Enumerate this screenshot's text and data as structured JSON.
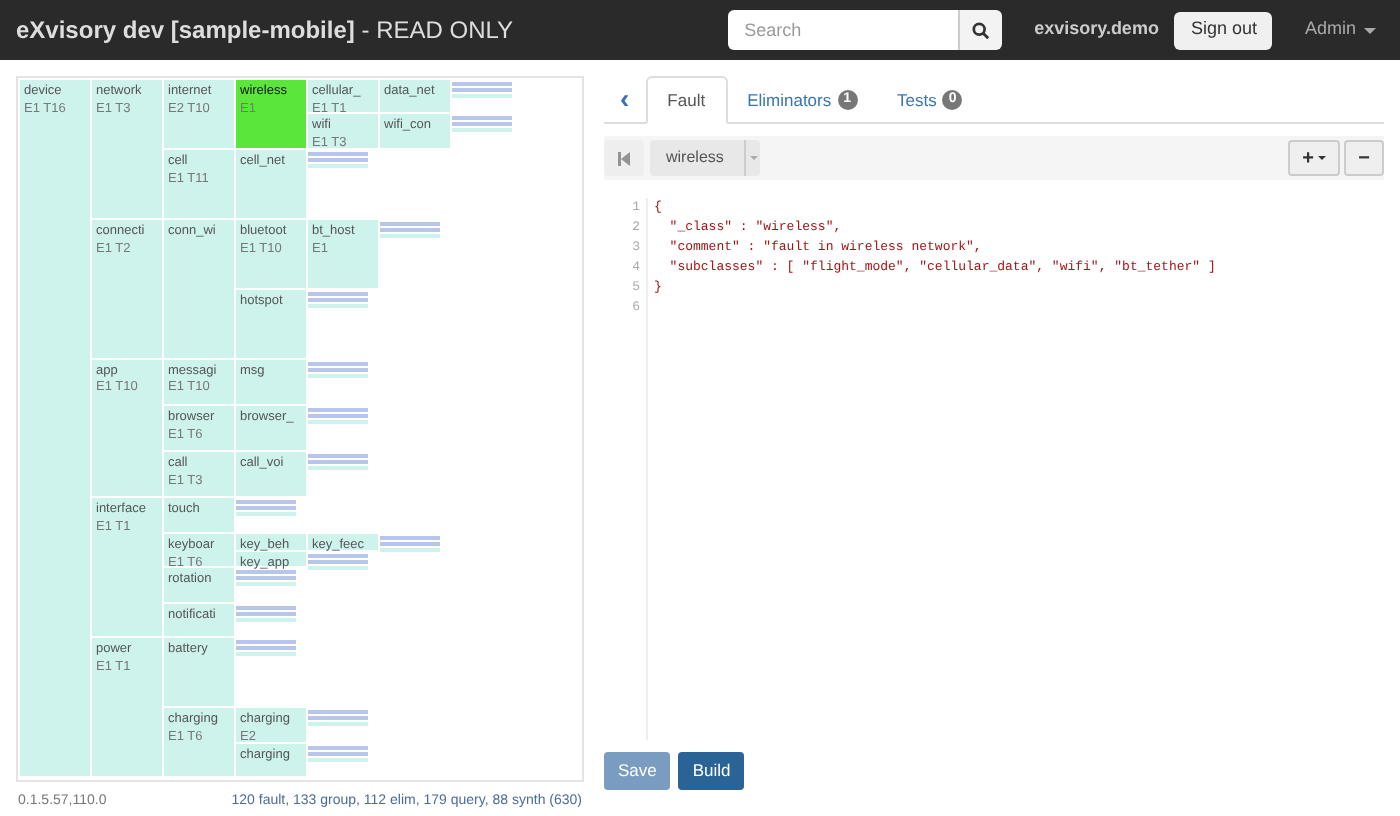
{
  "navbar": {
    "brand": "eXvisory dev [sample-mobile]",
    "mode": " - READ ONLY",
    "search": {
      "placeholder": "Search"
    },
    "user": "exvisory.demo",
    "sign_out": "Sign out",
    "menu": "Admin"
  },
  "tree": [
    {
      "name": "device",
      "info": "E1 T16",
      "selected": false,
      "children": [
        {
          "name": "network",
          "info": "E1 T3",
          "selected": false,
          "children": [
            {
              "name": "internet",
              "info": "E2 T10",
              "selected": false,
              "children": [
                {
                  "name": "wireless",
                  "info": "E1",
                  "selected": true,
                  "children": [
                    {
                      "name": "cellular_",
                      "info": "E1 T1",
                      "selected": false,
                      "children": [
                        {
                          "name": "data_net",
                          "selected": false
                        }
                      ]
                    },
                    {
                      "name": "wifi",
                      "info": "E1 T3",
                      "selected": false,
                      "children": [
                        {
                          "name": "wifi_con",
                          "selected": false
                        }
                      ]
                    }
                  ]
                }
              ]
            },
            {
              "name": "cell",
              "info": "E1 T11",
              "selected": false,
              "children": [
                {
                  "name": "cell_net",
                  "selected": false
                }
              ]
            }
          ]
        },
        {
          "name": "connecti",
          "info": "E1 T2",
          "selected": false,
          "children": [
            {
              "name": "conn_wi",
              "selected": false,
              "children": [
                {
                  "name": "bluetoot",
                  "info": "E1 T10",
                  "selected": false,
                  "children": [
                    {
                      "name": "bt_host",
                      "info": "E1",
                      "selected": false
                    }
                  ]
                },
                {
                  "name": "hotspot",
                  "selected": false
                }
              ]
            }
          ]
        },
        {
          "name": "app",
          "info": "E1 T10",
          "selected": false,
          "children": [
            {
              "name": "messagi",
              "info": "E1 T10",
              "selected": false,
              "children": [
                {
                  "name": "msg",
                  "selected": false
                }
              ]
            },
            {
              "name": "browser",
              "info": "E1 T6",
              "selected": false,
              "children": [
                {
                  "name": "browser_",
                  "selected": false
                }
              ]
            },
            {
              "name": "call",
              "info": "E1 T3",
              "selected": false,
              "children": [
                {
                  "name": "call_voi",
                  "selected": false
                }
              ]
            }
          ]
        },
        {
          "name": "interface",
          "info": "E1 T1",
          "selected": false,
          "children": [
            {
              "name": "touch",
              "selected": false
            },
            {
              "name": "keyboar",
              "info": "E1 T6",
              "selected": false,
              "children": [
                {
                  "name": "key_beh",
                  "selected": false,
                  "children": [
                    {
                      "name": "key_feec",
                      "selected": false
                    }
                  ]
                },
                {
                  "name": "key_app",
                  "selected": false
                }
              ]
            },
            {
              "name": "rotation",
              "selected": false
            },
            {
              "name": "notificati",
              "selected": false
            }
          ]
        },
        {
          "name": "power",
          "info": "E1 T1",
          "selected": false,
          "children": [
            {
              "name": "battery",
              "selected": false
            },
            {
              "name": "charging",
              "info": "E1 T6",
              "selected": false,
              "children": [
                {
                  "name": "charging",
                  "info": "E2",
                  "selected": false
                },
                {
                  "name": "charging",
                  "selected": false
                }
              ]
            }
          ]
        }
      ]
    }
  ],
  "footer": {
    "version": "0.1.5.57,110.0",
    "stats": "120 fault, 133 group, 112 elim, 179 query, 88 synth (630)"
  },
  "back": "‹",
  "tabs": [
    {
      "label": "Fault",
      "selected": true
    },
    {
      "label": "Eliminators",
      "count": "1",
      "selected": false
    },
    {
      "label": "Tests",
      "count": "0",
      "selected": false
    }
  ],
  "toolbar": {
    "first_disabled": true,
    "select": "wireless",
    "add": "+",
    "remove": "−"
  },
  "editor": {
    "lines": [
      {
        "number": "1",
        "text": "{"
      },
      {
        "number": "2",
        "text": "  \"_class\" : \"wireless\","
      },
      {
        "number": "3",
        "text": "  \"comment\" : \"fault in wireless network\","
      },
      {
        "number": "4",
        "text": "  \"subclasses\" : [ \"flight_mode\", \"cellular_data\", \"wifi\", \"bt_tether\" ]"
      },
      {
        "number": "5",
        "text": "}"
      },
      {
        "number": "6"
      }
    ]
  },
  "buttons": [
    {
      "label": "Save",
      "disabled": true
    },
    {
      "label": "Build",
      "disabled": false
    }
  ]
}
